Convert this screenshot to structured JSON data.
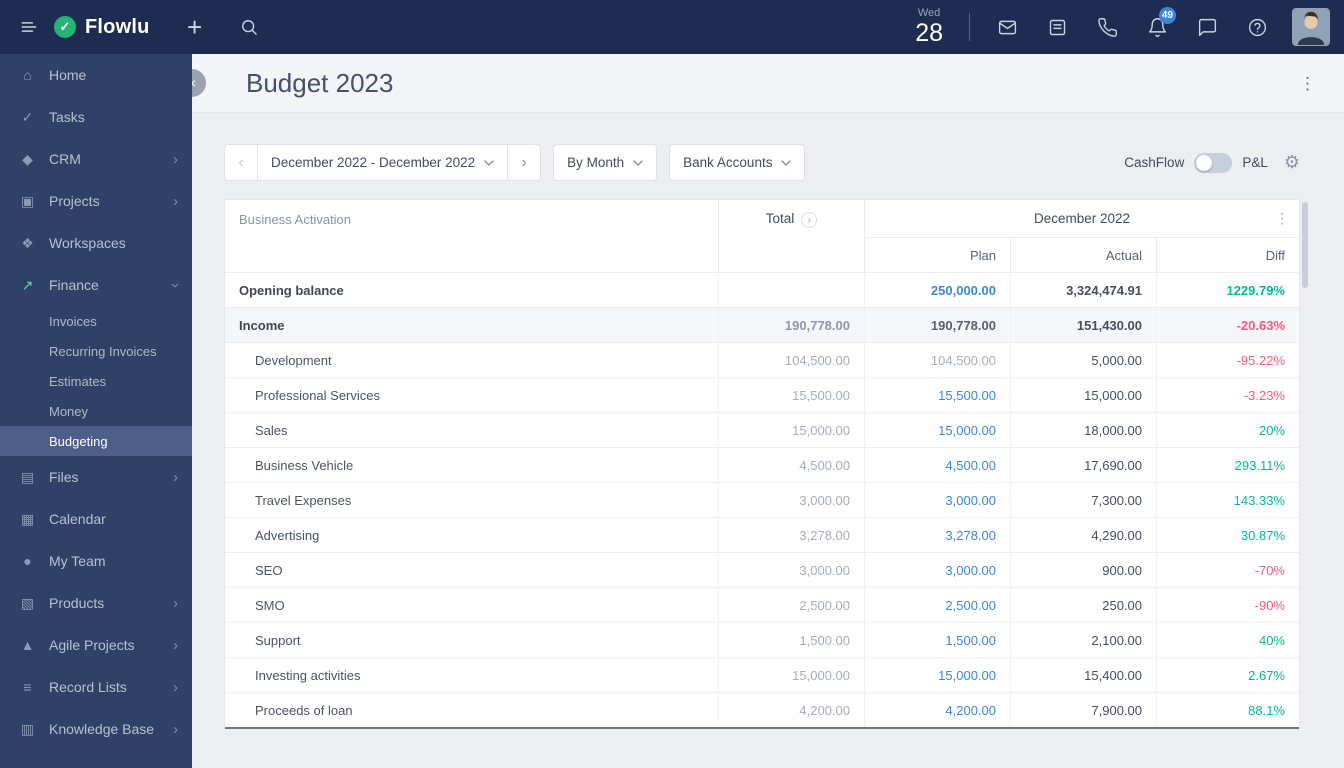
{
  "topbar": {
    "brand": "Flowlu",
    "weekday": "Wed",
    "day": "28",
    "notifications": "49"
  },
  "page": {
    "title": "Budget 2023"
  },
  "toolbar": {
    "period": "December 2022 - December 2022",
    "group_by": "By Month",
    "accounts": "Bank Accounts",
    "toggle_left": "CashFlow",
    "toggle_right": "P&L"
  },
  "sidebar": {
    "items": [
      {
        "label": "Home",
        "icon": "home",
        "glyph": "⌂"
      },
      {
        "label": "Tasks",
        "icon": "tasks",
        "glyph": "✓"
      },
      {
        "label": "CRM",
        "icon": "crm",
        "glyph": "◆",
        "chevron": true
      },
      {
        "label": "Projects",
        "icon": "projects",
        "glyph": "▣",
        "chevron": true
      },
      {
        "label": "Workspaces",
        "icon": "workspaces",
        "glyph": "❖"
      },
      {
        "label": "Finance",
        "icon": "finance",
        "glyph": "↗",
        "icon_color": "#66d3c0",
        "expanded": true,
        "children": [
          "Invoices",
          "Recurring Invoices",
          "Estimates",
          "Money",
          "Budgeting"
        ],
        "active_child": "Budgeting"
      },
      {
        "label": "Files",
        "icon": "files",
        "glyph": "▤",
        "chevron": true
      },
      {
        "label": "Calendar",
        "icon": "calendar",
        "glyph": "▦"
      },
      {
        "label": "My Team",
        "icon": "my-team",
        "glyph": "●"
      },
      {
        "label": "Products",
        "icon": "products",
        "glyph": "▧",
        "chevron": true
      },
      {
        "label": "Agile Projects",
        "icon": "agile-projects",
        "glyph": "▲",
        "chevron": true
      },
      {
        "label": "Record Lists",
        "icon": "record-lists",
        "glyph": "≡",
        "chevron": true
      },
      {
        "label": "Knowledge Base",
        "icon": "knowledge-base",
        "glyph": "▥",
        "chevron": true
      }
    ]
  },
  "table": {
    "corner_label": "Business Activation",
    "total_label": "Total",
    "month_label": "December 2022",
    "sub_columns": [
      "Plan",
      "Actual",
      "Diff"
    ],
    "rows": [
      {
        "name": "Opening balance",
        "emphasis": true,
        "total": "",
        "plan": "250,000.00",
        "plan_style": "blue",
        "actual": "3,324,474.91",
        "diff": "1229.79%"
      },
      {
        "name": "Income",
        "emphasis": true,
        "shaded": true,
        "total": "190,778.00",
        "plan": "190,778.00",
        "plan_style": "dark",
        "actual": "151,430.00",
        "diff": "-20.63%"
      },
      {
        "name": "Development",
        "indent": true,
        "total": "104,500.00",
        "plan": "104,500.00",
        "plan_style": "muted",
        "actual": "5,000.00",
        "diff": "-95.22%"
      },
      {
        "name": "Professional Services",
        "indent": true,
        "total": "15,500.00",
        "plan": "15,500.00",
        "plan_style": "blue",
        "actual": "15,000.00",
        "diff": "-3.23%"
      },
      {
        "name": "Sales",
        "indent": true,
        "total": "15,000.00",
        "plan": "15,000.00",
        "plan_style": "blue",
        "actual": "18,000.00",
        "diff": "20%"
      },
      {
        "name": "Business Vehicle",
        "indent": true,
        "total": "4,500.00",
        "plan": "4,500.00",
        "plan_style": "blue",
        "actual": "17,690.00",
        "diff": "293.11%"
      },
      {
        "name": "Travel Expenses",
        "indent": true,
        "total": "3,000.00",
        "plan": "3,000.00",
        "plan_style": "blue",
        "actual": "7,300.00",
        "diff": "143.33%"
      },
      {
        "name": "Advertising",
        "indent": true,
        "total": "3,278.00",
        "plan": "3,278.00",
        "plan_style": "blue",
        "actual": "4,290.00",
        "diff": "30.87%"
      },
      {
        "name": "SEO",
        "indent": true,
        "total": "3,000.00",
        "plan": "3,000.00",
        "plan_style": "blue",
        "actual": "900.00",
        "diff": "-70%"
      },
      {
        "name": "SMO",
        "indent": true,
        "total": "2,500.00",
        "plan": "2,500.00",
        "plan_style": "blue",
        "actual": "250.00",
        "diff": "-90%"
      },
      {
        "name": "Support",
        "indent": true,
        "total": "1,500.00",
        "plan": "1,500.00",
        "plan_style": "blue",
        "actual": "2,100.00",
        "diff": "40%"
      },
      {
        "name": "Investing activities",
        "indent": true,
        "total": "15,000.00",
        "plan": "15,000.00",
        "plan_style": "blue",
        "actual": "15,400.00",
        "diff": "2.67%"
      },
      {
        "name": "Proceeds of loan",
        "indent": true,
        "total": "4,200.00",
        "plan": "4,200.00",
        "plan_style": "blue",
        "actual": "7,900.00",
        "diff": "88.1%"
      }
    ]
  },
  "colors": {
    "positive": "#00b9a0",
    "negative": "#f9587d",
    "plan_blue": "#3d87d8",
    "brand_green": "#22b573",
    "badge_blue": "#3d87d8",
    "topbar_bg": "#1d2c50",
    "sidebar_bg": "#2f4166"
  }
}
